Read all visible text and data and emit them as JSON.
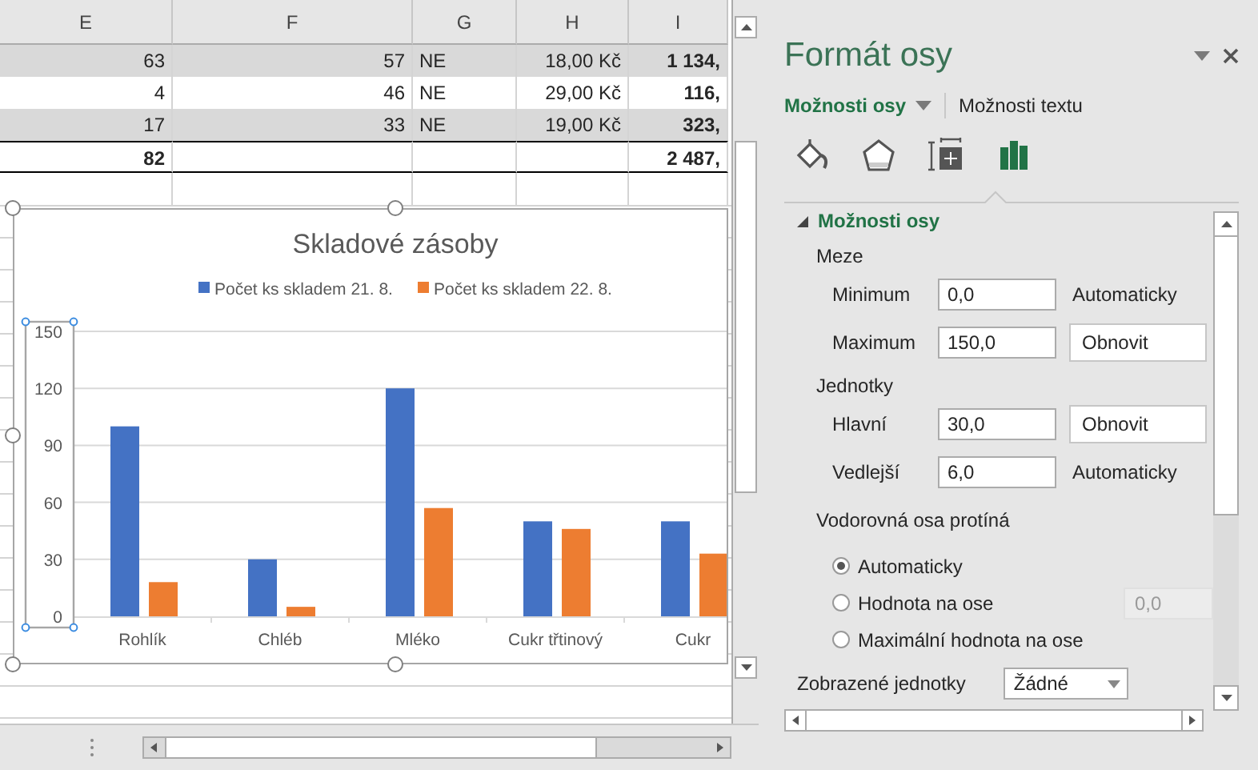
{
  "sheet": {
    "columns": [
      "E",
      "F",
      "G",
      "H",
      "I"
    ],
    "rows": [
      {
        "shaded": true,
        "total": false,
        "cells": [
          "63",
          "57",
          "NE",
          "18,00 Kč",
          "1 134,"
        ]
      },
      {
        "shaded": false,
        "total": false,
        "cells": [
          "4",
          "46",
          "NE",
          "29,00 Kč",
          "116,"
        ]
      },
      {
        "shaded": true,
        "total": false,
        "cells": [
          "17",
          "33",
          "NE",
          "19,00 Kč",
          "323,"
        ]
      },
      {
        "shaded": false,
        "total": true,
        "cells": [
          "82",
          null,
          null,
          null,
          "2 487,"
        ]
      }
    ]
  },
  "chart": {
    "axis_selected": true,
    "chart_data": {
      "type": "bar",
      "title": "Skladové zásoby",
      "categories": [
        "Rohlík",
        "Chléb",
        "Mléko",
        "Cukr třtinový",
        "Cukr"
      ],
      "series": [
        {
          "name": "Počet ks skladem 21. 8.",
          "color": "#4472c4",
          "values": [
            100,
            30,
            120,
            50,
            50
          ]
        },
        {
          "name": "Počet ks skladem 22. 8.",
          "color": "#ed7d31",
          "values": [
            18,
            5,
            57,
            46,
            33
          ]
        }
      ],
      "grid": true,
      "legend": true,
      "ylim": [
        0,
        150
      ],
      "yticks": [
        0,
        30,
        60,
        90,
        120,
        150
      ]
    }
  },
  "panel": {
    "title": "Formát osy",
    "tabs": [
      {
        "label": "Možnosti osy",
        "selected": true
      },
      {
        "label": "Možnosti textu",
        "selected": false
      }
    ],
    "icon_tabs": [
      {
        "kind": "fill",
        "selected": false
      },
      {
        "kind": "effects",
        "selected": false
      },
      {
        "kind": "size",
        "selected": false
      },
      {
        "kind": "axis",
        "selected": true
      }
    ],
    "section": {
      "title": "Možnosti osy",
      "expanded": true
    },
    "groups": [
      {
        "label": "Meze",
        "rows": [
          {
            "label": "Minimum",
            "value": "0,0",
            "kind": "auto",
            "action": "Automaticky"
          },
          {
            "label": "Maximum",
            "value": "150,0",
            "kind": "reset",
            "action": "Obnovit"
          }
        ]
      },
      {
        "label": "Jednotky",
        "rows": [
          {
            "label": "Hlavní",
            "value": "30,0",
            "kind": "reset",
            "action": "Obnovit"
          },
          {
            "label": "Vedlejší",
            "value": "6,0",
            "kind": "auto",
            "action": "Automaticky"
          }
        ]
      }
    ],
    "crossing": {
      "label": "Vodorovná osa protíná",
      "options": [
        {
          "label": "Automaticky",
          "selected": true
        },
        {
          "label": "Hodnota na ose",
          "selected": false,
          "value": "0,0",
          "disabled": true
        },
        {
          "label": "Maximální hodnota na ose",
          "selected": false
        }
      ]
    },
    "display_units": {
      "label": "Zobrazené jednotky",
      "value": "Žádné"
    }
  }
}
